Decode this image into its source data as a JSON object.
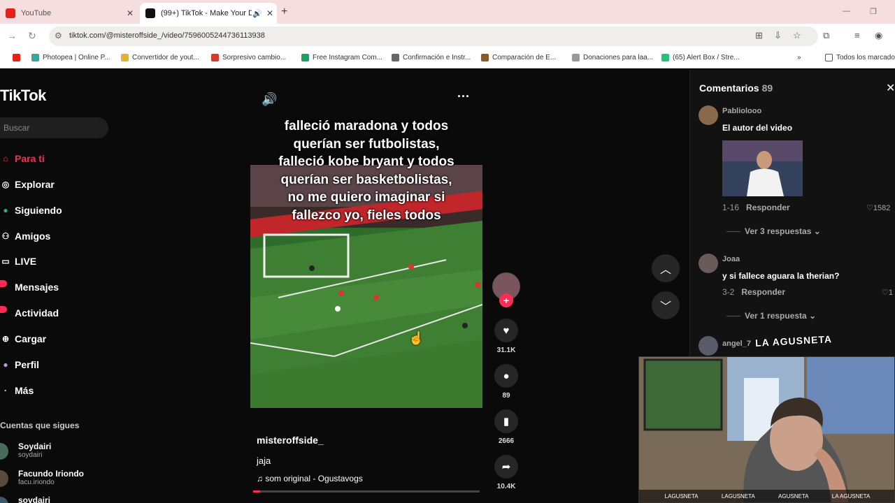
{
  "browser": {
    "tabs": [
      {
        "title": "YouTube",
        "active": false
      },
      {
        "title": "(99+) TikTok - Make Your Da",
        "active": true
      }
    ],
    "url": "tiktok.com/@misteroffside_/video/7596005244736113938",
    "bookmarks": [
      "Photopea | Online P...",
      "Convertidor de yout...",
      "Sorpresivo cambio...",
      "Free Instagram Com...",
      "Confirmación e Instr...",
      "Comparación de E...",
      "Donaciones para laa...",
      "(65) Alert Box / Stre...",
      "Todos los marcado"
    ]
  },
  "sidebar": {
    "logo": "TikTok",
    "search_placeholder": "Buscar",
    "items": [
      {
        "label": "Para ti",
        "active": true
      },
      {
        "label": "Explorar"
      },
      {
        "label": "Siguiendo"
      },
      {
        "label": "Amigos"
      },
      {
        "label": "LIVE"
      },
      {
        "label": "Mensajes"
      },
      {
        "label": "Actividad"
      },
      {
        "label": "Cargar"
      },
      {
        "label": "Perfil"
      },
      {
        "label": "Más"
      }
    ],
    "following_title": "Cuentas que sigues",
    "accounts": [
      {
        "name": "Soydairi",
        "handle": "soydairi"
      },
      {
        "name": "Facundo Iriondo",
        "handle": "facu.iriondo"
      },
      {
        "name": "sovdairi",
        "handle": ""
      }
    ]
  },
  "video": {
    "overlay_lines": [
      "falleció maradona y todos",
      "querían ser futbolistas,",
      "falleció kobe bryant y todos",
      "querían ser basketbolistas,",
      "no me quiero imaginar si",
      "fallezco yo, fieles todos"
    ],
    "author": "misteroffside_",
    "description": "jaja",
    "music": "som original - Ogustavogs",
    "progress_fraction": 0.03,
    "actions": {
      "likes": "31.1K",
      "comments": "89",
      "saves": "2666",
      "shares": "10.4K"
    }
  },
  "comments": {
    "title": "Comentarios",
    "count": "89",
    "list": [
      {
        "user": "Pabliolooo",
        "text": "El autor del video",
        "date": "1-16",
        "reply": "Responder",
        "likes": "1582",
        "view_replies": "Ver 3 respuestas"
      },
      {
        "user": "Joaa",
        "text": "y si fallece aguara la therian?",
        "date": "3-2",
        "reply": "Responder",
        "likes": "1",
        "view_replies": "Ver 1 respuesta"
      },
      {
        "user": "angel_7"
      }
    ]
  },
  "webcam": {
    "logo_text": "LA AGUSNETA",
    "socials": [
      "LAGUSNETA",
      "LAGUSNETA",
      "AGUSNETA",
      "LA AGUSNETA"
    ]
  }
}
